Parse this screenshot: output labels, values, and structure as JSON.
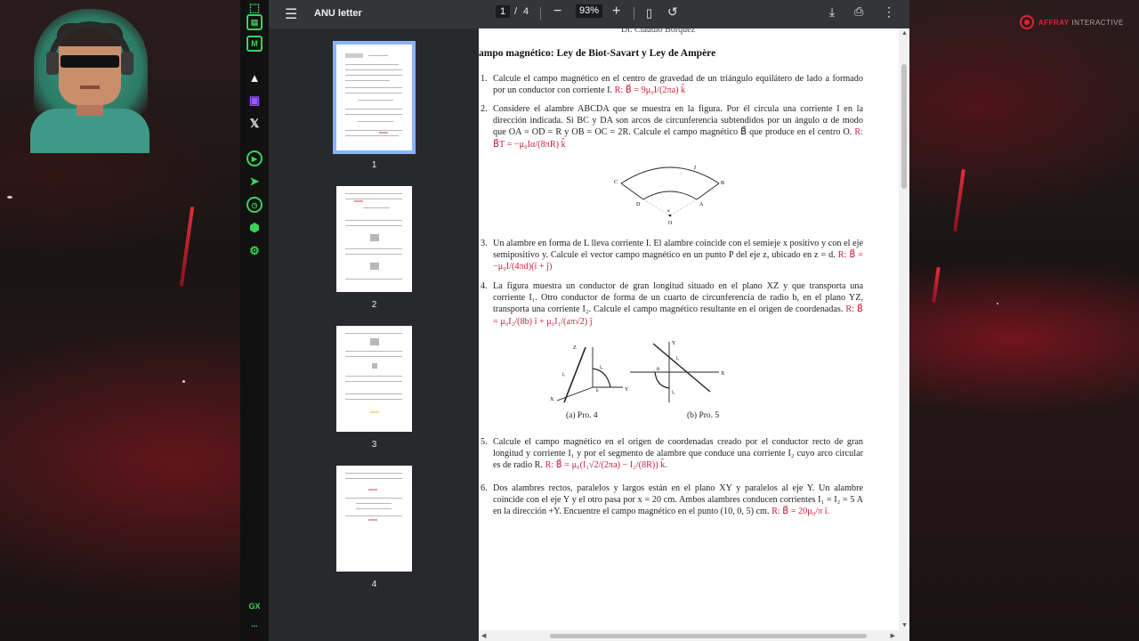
{
  "toolbar": {
    "title": "ANU letter",
    "current_page": "1",
    "separator": "/",
    "total_pages": "4",
    "zoom": "93%",
    "icons": [
      "menu-icon",
      "zoom-out-icon",
      "zoom-in-icon",
      "fit-page-icon",
      "rotate-icon",
      "download-icon",
      "print-icon",
      "more-icon"
    ]
  },
  "thumbnails": [
    {
      "label": "1"
    },
    {
      "label": "2"
    },
    {
      "label": "3"
    },
    {
      "label": "4"
    }
  ],
  "sidebar": {
    "gx_label": "GX",
    "more_label": "...",
    "icons": [
      "chart-icon",
      "news-icon",
      "m-icon",
      "aria-icon",
      "twitch-icon",
      "x-icon",
      "player-icon",
      "send-icon",
      "clock-icon",
      "extensions-icon",
      "settings-icon"
    ]
  },
  "brand": {
    "name": "AFFRAY",
    "suffix": "INTERACTIVE"
  },
  "document": {
    "header": "Dr. Claudio Bórquez",
    "title": "ampo magnético: Ley de Biot-Savart y Ley de Ampère",
    "problems": [
      {
        "num": "1.",
        "text": "Calcule el campo magnético en el centro de gravedad de un triángulo equilátero de lado a formado por un conductor con corriente I.",
        "answer": "R: B⃗ = 9μ₀I/(2πa) k̂"
      },
      {
        "num": "2.",
        "text": "Considere el alambre ABCDA que se muestra en la figura. Por él circula una corriente I en la dirección indicada. Si BC y DA son arcos de circunferencia subtendidos por un ángulo α de modo que OA = OD = R y OB = OC = 2R. Calcule el campo magnético B⃗ que produce en el centro O.",
        "answer": "R: B⃗T = −μ₀Iα/(8πR) k̂"
      },
      {
        "num": "3.",
        "text": "Un alambre en forma de L lleva corriente I. El alambre coincide con el semieje x positivo y con el eje semipositivo y. Calcule el vector campo magnético en un punto P del eje z, ubicado en z = d.",
        "answer": "R: B⃗ = −μ₀I/(4πd)(î + ĵ)"
      },
      {
        "num": "4.",
        "text": "La figura muestra un conductor de gran longitud situado en el plano XZ y que transporta una corriente I₁. Otro conductor de forma de un cuarto de circunferencia de radio b, en el plano YZ, transporta una corriente I₂. Calcule el campo magnético resultante en el origen de coordenadas.",
        "answer": "R: B⃗ = μ₀I₂/(8b) î + μ₀I₁/(aπ√2) ĵ"
      },
      {
        "num": "5.",
        "text": "Calcule el campo magnético en el origen de coordenadas creado por el conductor recto de gran longitud y corriente I₁ y por el segmento de alambre que conduce una corriente I₂ cuyo arco circular es de radio R.",
        "answer": "R: B⃗ = μ₀(I₁√2/(2πa) − I₂/(8R)) k̂."
      },
      {
        "num": "6.",
        "text": "Dos alambres rectos, paralelos y largos están en el plano XY y paralelos al eje Y. Un alambre coincide con el eje Y y el otro pasa por x = 20 cm. Ambos alambres conducen corrientes I₁ = I₂ = 5 A en la dirección +Y. Encuentre el campo magnético en el punto (10, 0, 5) cm.",
        "answer": "R: B⃗ = 20μ₀/π î."
      }
    ],
    "figure_captions": {
      "a": "(a) Pro. 4",
      "b": "(b) Pro. 5"
    },
    "fig2_labels": {
      "C": "C",
      "B": "B",
      "D": "D",
      "A": "A",
      "O": "O",
      "I": "I",
      "alpha": "α"
    },
    "fig4_labels": {
      "Z": "Z",
      "X": "X",
      "Y": "Y",
      "I1": "I₁",
      "I2": "I₂",
      "b": "b"
    },
    "fig5_labels": {
      "Y": "Y",
      "X": "X",
      "I1": "I₁",
      "I2": "I₂",
      "R": "R"
    }
  }
}
